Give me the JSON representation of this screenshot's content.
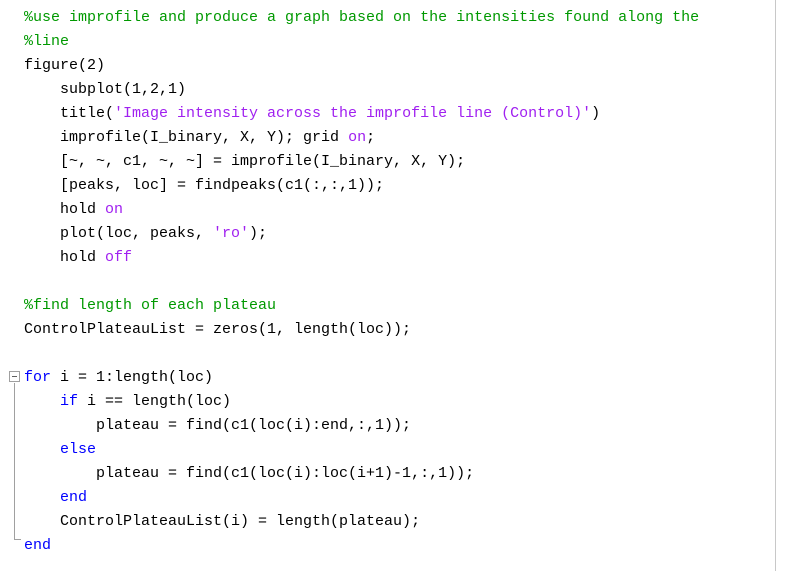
{
  "editor": {
    "name": "matlab-code-editor",
    "background": "#ffffff",
    "ruler_color": "#c8c8c8",
    "font_size_px": 15,
    "line_height_px": 24,
    "colors": {
      "comment": "#009900",
      "string": "#A020F0",
      "keyword": "#0000FF",
      "plain": "#000000",
      "fold_marker": "#a0a0a0"
    },
    "fold_marker": {
      "glyph": "minus-square",
      "expanded": true,
      "start_line_index": 15,
      "end_line_index": 21
    },
    "lines": [
      {
        "index": 0,
        "tokens": [
          {
            "t": "comment",
            "s": "%use improfile and produce a graph based on the intensities found along the"
          }
        ]
      },
      {
        "index": 1,
        "tokens": [
          {
            "t": "comment",
            "s": "%line"
          }
        ]
      },
      {
        "index": 2,
        "tokens": [
          {
            "t": "plain",
            "s": "figure(2)"
          }
        ]
      },
      {
        "index": 3,
        "tokens": [
          {
            "t": "plain",
            "s": "    subplot(1,2,1)"
          }
        ]
      },
      {
        "index": 4,
        "tokens": [
          {
            "t": "plain",
            "s": "    title("
          },
          {
            "t": "string",
            "s": "'Image intensity across the improfile line (Control)'"
          },
          {
            "t": "plain",
            "s": ")"
          }
        ]
      },
      {
        "index": 5,
        "tokens": [
          {
            "t": "plain",
            "s": "    improfile(I_binary, X, Y); grid "
          },
          {
            "t": "string",
            "s": "on"
          },
          {
            "t": "plain",
            "s": ";"
          }
        ]
      },
      {
        "index": 6,
        "tokens": [
          {
            "t": "plain",
            "s": "    [~, ~, c1, ~, ~] = improfile(I_binary, X, Y);"
          }
        ]
      },
      {
        "index": 7,
        "tokens": [
          {
            "t": "plain",
            "s": "    [peaks, loc] = findpeaks(c1(:,:,1));"
          }
        ]
      },
      {
        "index": 8,
        "tokens": [
          {
            "t": "plain",
            "s": "    hold "
          },
          {
            "t": "string",
            "s": "on"
          }
        ]
      },
      {
        "index": 9,
        "tokens": [
          {
            "t": "plain",
            "s": "    plot(loc, peaks, "
          },
          {
            "t": "string",
            "s": "'ro'"
          },
          {
            "t": "plain",
            "s": ");"
          }
        ]
      },
      {
        "index": 10,
        "tokens": [
          {
            "t": "plain",
            "s": "    hold "
          },
          {
            "t": "string",
            "s": "off"
          }
        ]
      },
      {
        "index": 11,
        "tokens": [
          {
            "t": "plain",
            "s": ""
          }
        ]
      },
      {
        "index": 12,
        "tokens": [
          {
            "t": "comment",
            "s": "%find length of each plateau"
          }
        ]
      },
      {
        "index": 13,
        "tokens": [
          {
            "t": "plain",
            "s": "ControlPlateauList = zeros(1, length(loc));"
          }
        ]
      },
      {
        "index": 14,
        "tokens": [
          {
            "t": "plain",
            "s": ""
          }
        ]
      },
      {
        "index": 15,
        "tokens": [
          {
            "t": "keyword",
            "s": "for"
          },
          {
            "t": "plain",
            "s": " i = 1:length(loc)"
          }
        ]
      },
      {
        "index": 16,
        "tokens": [
          {
            "t": "plain",
            "s": "    "
          },
          {
            "t": "keyword",
            "s": "if"
          },
          {
            "t": "plain",
            "s": " i == length(loc)"
          }
        ]
      },
      {
        "index": 17,
        "tokens": [
          {
            "t": "plain",
            "s": "        plateau = find(c1(loc(i):end,:,1));"
          }
        ]
      },
      {
        "index": 18,
        "tokens": [
          {
            "t": "plain",
            "s": "    "
          },
          {
            "t": "keyword",
            "s": "else"
          }
        ]
      },
      {
        "index": 19,
        "tokens": [
          {
            "t": "plain",
            "s": "        plateau = find(c1(loc(i):loc(i+1)-1,:,1));"
          }
        ]
      },
      {
        "index": 20,
        "tokens": [
          {
            "t": "plain",
            "s": "    "
          },
          {
            "t": "keyword",
            "s": "end"
          }
        ]
      },
      {
        "index": 21,
        "tokens": [
          {
            "t": "plain",
            "s": "    ControlPlateauList(i) = length(plateau);"
          }
        ]
      },
      {
        "index": 22,
        "tokens": [
          {
            "t": "keyword",
            "s": "end"
          }
        ]
      }
    ]
  }
}
